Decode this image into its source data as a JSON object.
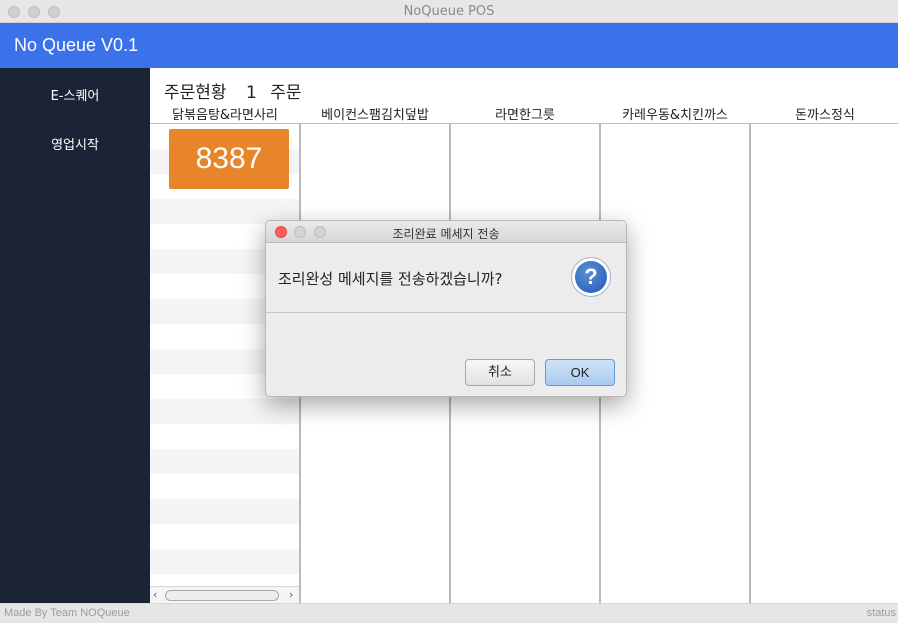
{
  "window": {
    "title": "NoQueue POS"
  },
  "header": {
    "app_title": "No Queue V0.1",
    "accent_color": "#3b72ea"
  },
  "sidebar": {
    "items": [
      {
        "label": "E-스퀘어"
      },
      {
        "label": "영업시작"
      }
    ]
  },
  "orders": {
    "status_label": "주문현황",
    "count": "1",
    "count_unit": "주문",
    "columns": [
      {
        "label": "닭볶음탕&라면사리"
      },
      {
        "label": "베이컨스팸김치덮밥"
      },
      {
        "label": "라면한그릇"
      },
      {
        "label": "카레우동&치킨까스"
      },
      {
        "label": "돈까스정식"
      }
    ],
    "cards": [
      {
        "number": "8387",
        "color": "#e8852a"
      }
    ]
  },
  "statusbar": {
    "left": "Made By Team NOQueue",
    "right": "status"
  },
  "dialog": {
    "title": "조리완료 메세지 전송",
    "message": "조리완성 메세지를 전송하겠습니까?",
    "icon": "question-icon",
    "cancel_label": "취소",
    "ok_label": "OK"
  }
}
